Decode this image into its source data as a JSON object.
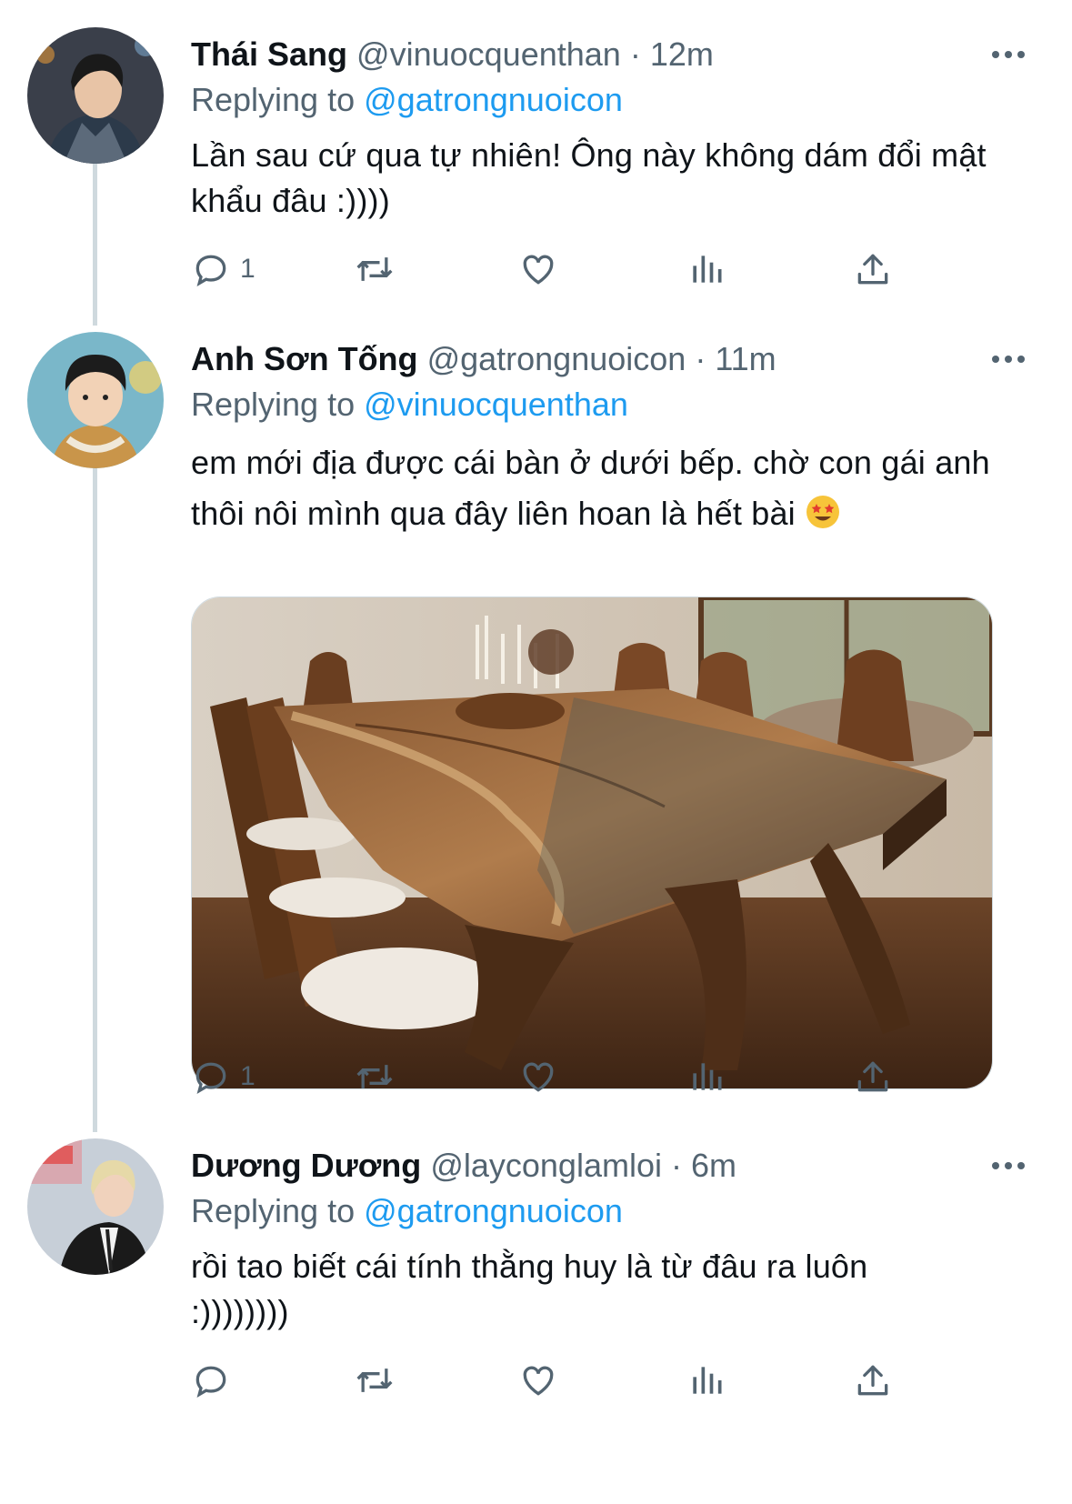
{
  "tweets": [
    {
      "name": "Thái Sang",
      "handle": "@vinuocquenthan",
      "time": "12m",
      "replying_label": "Replying to",
      "replying_to": "@gatrongnuoicon",
      "text": "Lần sau cứ qua tự nhiên! Ông này không dám đổi mật khẩu đâu :))))",
      "reply_count": "1"
    },
    {
      "name": "Anh Sơn Tống",
      "handle": "@gatrongnuoicon",
      "time": "11m",
      "replying_label": "Replying to",
      "replying_to": "@vinuocquenthan",
      "text": "em mới địa được cái bàn ở dưới bếp. chờ con gái anh thôi nôi mình qua đây liên hoan là hết bài",
      "reply_count": "1",
      "emoji": "star-struck-emoji"
    },
    {
      "name": "Dương Dương",
      "handle": "@layconglamloi",
      "time": "6m",
      "replying_label": "Replying to",
      "replying_to": "@gatrongnuoicon",
      "text": "rồi tao biết cái tính thằng huy là từ đâu ra luôn :))))))))",
      "reply_count": ""
    }
  ],
  "separator": " · ",
  "icons": [
    "more-icon",
    "reply-icon",
    "retweet-icon",
    "like-icon",
    "views-icon",
    "share-icon"
  ],
  "colors": {
    "accent": "#1d9bf0",
    "secondary_text": "#536471",
    "thread_line": "#cfd9de"
  }
}
